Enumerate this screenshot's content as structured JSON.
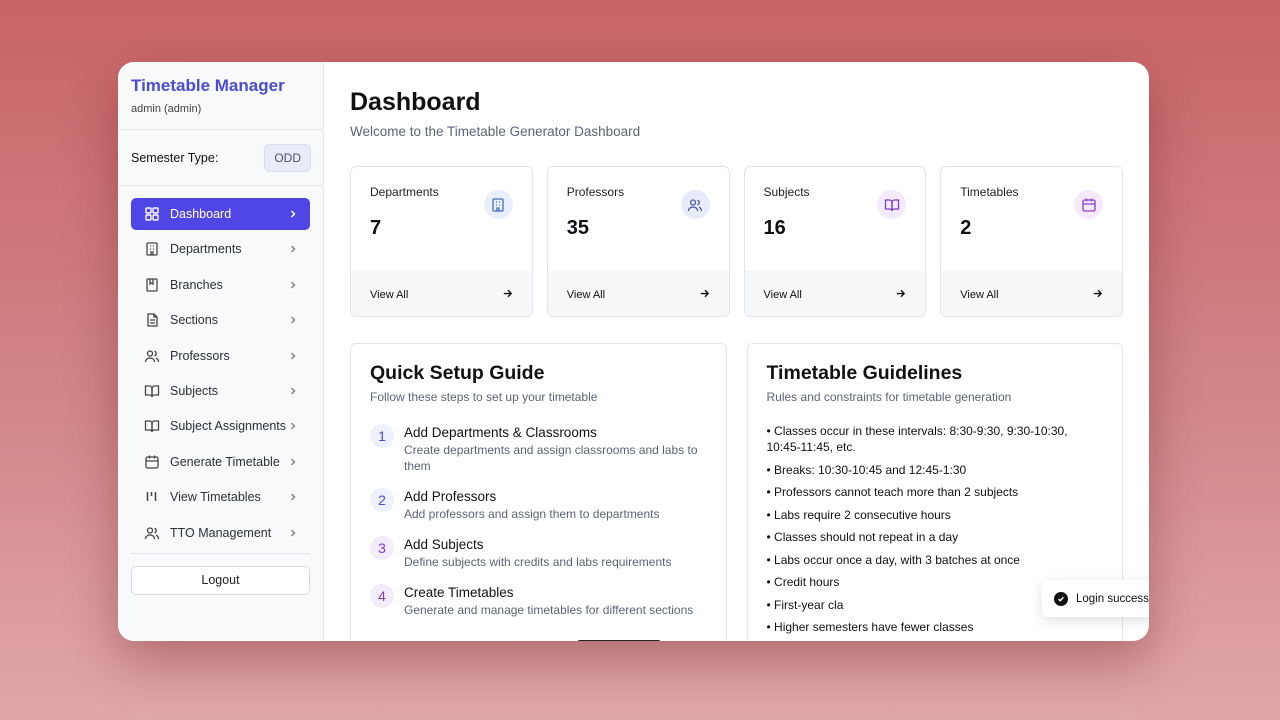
{
  "brand": {
    "title": "Timetable Manager",
    "user": "admin (admin)"
  },
  "semester": {
    "label": "Semester Type:",
    "value": "ODD"
  },
  "nav": {
    "items": [
      {
        "label": "Dashboard",
        "icon": "grid-icon"
      },
      {
        "label": "Departments",
        "icon": "building-icon"
      },
      {
        "label": "Branches",
        "icon": "bookmark-book-icon"
      },
      {
        "label": "Sections",
        "icon": "document-icon"
      },
      {
        "label": "Professors",
        "icon": "users-icon"
      },
      {
        "label": "Subjects",
        "icon": "book-open-icon"
      },
      {
        "label": "Subject Assignments",
        "icon": "book-open-icon"
      },
      {
        "label": "Generate Timetable",
        "icon": "calendar-icon"
      },
      {
        "label": "View Timetables",
        "icon": "columns-icon"
      },
      {
        "label": "TTO Management",
        "icon": "users-icon"
      }
    ],
    "logout": "Logout"
  },
  "header": {
    "title": "Dashboard",
    "subtitle": "Welcome to the Timetable Generator Dashboard"
  },
  "stats": [
    {
      "label": "Departments",
      "value": "7",
      "link": "View All",
      "icon": "building-icon",
      "color": "#4b6fb8"
    },
    {
      "label": "Professors",
      "value": "35",
      "link": "View All",
      "icon": "users-icon",
      "color": "#4a5aa8"
    },
    {
      "label": "Subjects",
      "value": "16",
      "link": "View All",
      "icon": "book-open-icon",
      "color": "#7a3fc0"
    },
    {
      "label": "Timetables",
      "value": "2",
      "link": "View All",
      "icon": "calendar-icon",
      "color": "#8a3fc0"
    }
  ],
  "setup": {
    "title": "Quick Setup Guide",
    "subtitle": "Follow these steps to set up your timetable",
    "steps": [
      {
        "num": "1",
        "title": "Add Departments & Classrooms",
        "desc": "Create departments and assign classrooms and labs to them"
      },
      {
        "num": "2",
        "title": "Add Professors",
        "desc": "Add professors and assign them to departments"
      },
      {
        "num": "3",
        "title": "Add Subjects",
        "desc": "Define subjects with credits and labs requirements"
      },
      {
        "num": "4",
        "title": "Create Timetables",
        "desc": "Generate and manage timetables for different sections"
      }
    ]
  },
  "guidelines": {
    "title": "Timetable Guidelines",
    "subtitle": "Rules and constraints for timetable generation",
    "items": [
      "• Classes occur in these intervals: 8:30-9:30, 9:30-10:30, 10:45-11:45, etc.",
      "• Breaks: 10:30-10:45 and 12:45-1:30",
      "• Professors cannot teach more than 2 subjects",
      "• Labs require 2 consecutive hours",
      "• Classes should not repeat in a day",
      "• Labs occur once a day, with 3 batches at once",
      "• Credit hours",
      "• First-year cla",
      "• Higher semesters have fewer classes"
    ]
  },
  "toast": {
    "text": "Login successful"
  },
  "colors": {
    "accent": "#4f46e5",
    "brand": "#4b4cd1"
  }
}
